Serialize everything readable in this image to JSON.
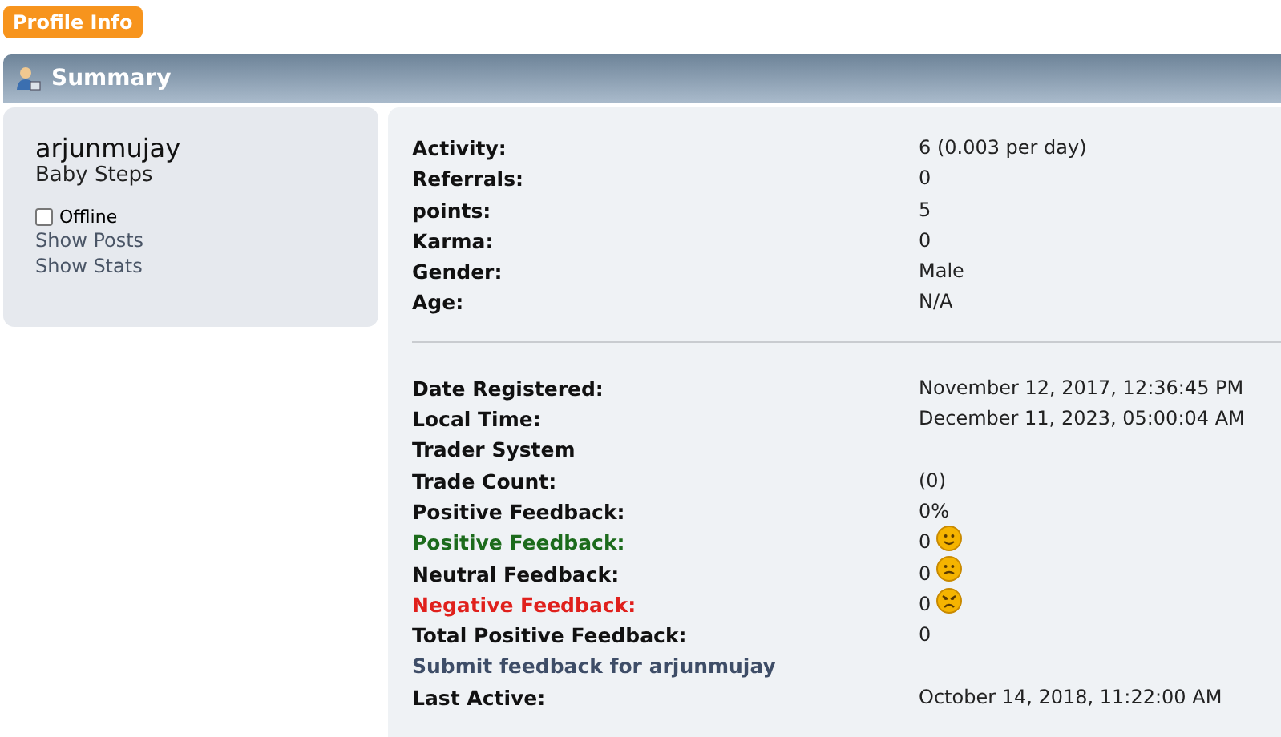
{
  "header_badge": "Profile Info",
  "section_title": "Summary",
  "profile": {
    "username": "arjunmujay",
    "rank": "Baby Steps",
    "status": {
      "label": "Offline",
      "checked": false
    },
    "links": [
      "Show Posts",
      "Show Stats"
    ]
  },
  "groups": [
    {
      "rows": [
        {
          "label": "Activity:",
          "kind": "field",
          "value": "6 (0.003 per day)"
        },
        {
          "label": "Referrals:",
          "kind": "field",
          "value": "0"
        },
        {
          "label": "points:",
          "kind": "field",
          "value": "5"
        },
        {
          "label": "Karma:",
          "kind": "field",
          "value": "0"
        },
        {
          "label": "Gender:",
          "kind": "field",
          "value": "Male"
        },
        {
          "label": "Age:",
          "kind": "field",
          "value": "N/A"
        }
      ]
    },
    {
      "rows": [
        {
          "label": "Date Registered:",
          "kind": "field",
          "value": "November 12, 2017, 12:36:45 PM"
        },
        {
          "label": "Local Time:",
          "kind": "field",
          "value": "December 11, 2023, 05:00:04 AM"
        },
        {
          "label": "Trader System",
          "kind": "field"
        },
        {
          "label": "Trade Count:",
          "kind": "field",
          "value": "(0)"
        },
        {
          "label": "Positive Feedback:",
          "kind": "field",
          "value": "0%"
        },
        {
          "label": "Positive Feedback:",
          "kind": "positive",
          "value": "0"
        },
        {
          "label": "Neutral Feedback:",
          "kind": "neutral",
          "value": "0"
        },
        {
          "label": "Negative Feedback:",
          "kind": "negative",
          "value": "0"
        },
        {
          "label": "Total Positive Feedback:",
          "kind": "field",
          "value": "0"
        },
        {
          "label": "Submit feedback for arjunmujay",
          "kind": "link"
        },
        {
          "label": "Last Active:",
          "kind": "field",
          "value": "October 14, 2018, 11:22:00 AM"
        }
      ]
    }
  ]
}
